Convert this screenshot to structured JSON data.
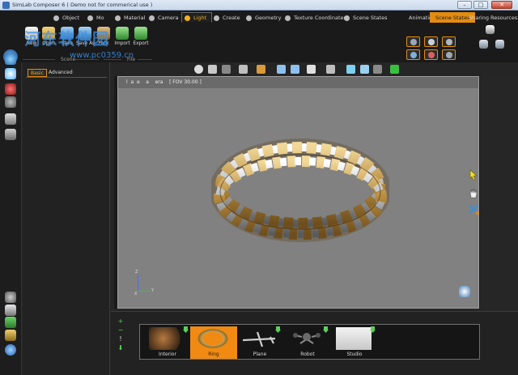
{
  "window": {
    "title": "SimLab Composer 6 ( Demo not for commerical use )",
    "minimize": "–",
    "maximize": "□",
    "close": "✕"
  },
  "ribbon": {
    "tabs": [
      {
        "label": "Object",
        "icon": "object-icon"
      },
      {
        "label": "Mo",
        "icon": "modeling-icon"
      },
      {
        "label": "Material",
        "icon": "material-icon"
      },
      {
        "label": "Camera",
        "icon": "camera-icon"
      },
      {
        "label": "Light",
        "icon": "light-icon",
        "active": true
      },
      {
        "label": "Create",
        "icon": "create-icon"
      },
      {
        "label": "Geometry",
        "icon": "geometry-icon"
      },
      {
        "label": "Texture Coordinates",
        "icon": "texture-icon"
      },
      {
        "label": "Scene States",
        "icon": "scene-states-icon"
      }
    ],
    "workspace_tabs": [
      {
        "label": "Animation"
      },
      {
        "label": "Scene States",
        "active": true
      },
      {
        "label": "Sharing Resources"
      }
    ],
    "buttons": [
      {
        "label": "New",
        "icon": "new-icon"
      },
      {
        "label": "Open",
        "icon": "open-icon"
      },
      {
        "label": "Save",
        "icon": "save-icon"
      },
      {
        "label": "Save As",
        "icon": "save-as-icon"
      },
      {
        "label": "Pack",
        "icon": "pack-icon"
      },
      {
        "label": "Import",
        "icon": "import-icon"
      },
      {
        "label": "Export",
        "icon": "export-icon"
      }
    ],
    "groups": {
      "scene": "Scene",
      "file": "File"
    }
  },
  "panel": {
    "tabs": [
      {
        "label": "Basic",
        "active": true
      },
      {
        "label": "Advanced"
      }
    ]
  },
  "viewport": {
    "label": "l  a  e    a    era    [ FOV 30.00 ]",
    "axis": {
      "x": "X",
      "y": "Y",
      "z": "Z"
    },
    "background": "#818181"
  },
  "library": {
    "items": [
      {
        "name": "Interior"
      },
      {
        "name": "Ring",
        "selected": true
      },
      {
        "name": "Plane"
      },
      {
        "name": "Robot"
      },
      {
        "name": "Studio"
      }
    ],
    "side": {
      "add": "+",
      "remove": "−",
      "info": "!",
      "download": "⬇"
    }
  },
  "watermark": {
    "main": "河东软件园",
    "url": "www.pc0359.cn"
  },
  "colors": {
    "accent": "#e38c12",
    "active_text": "#f5b21c"
  }
}
